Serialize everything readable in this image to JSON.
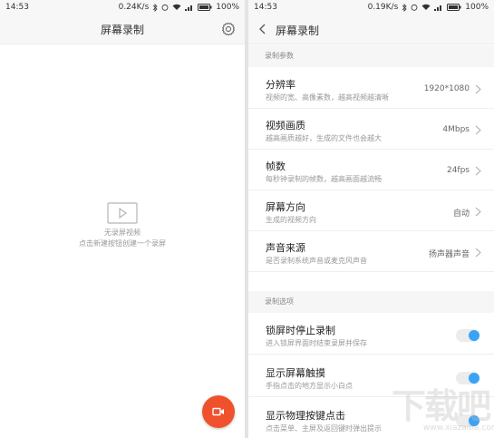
{
  "left": {
    "status": {
      "time": "14:53",
      "speed": "0.24K/s",
      "battery": "100%"
    },
    "title": "屏幕录制",
    "empty_line1": "无录屏视频",
    "empty_line2": "点击新建按钮创建一个录屏"
  },
  "right": {
    "status": {
      "time": "14:53",
      "speed": "0.19K/s",
      "battery": "100%"
    },
    "title": "屏幕录制",
    "section_params": "录制参数",
    "settings": [
      {
        "label": "分辨率",
        "desc": "视频的宽、高像素数，越高视频越清晰",
        "value": "1920*1080"
      },
      {
        "label": "视频画质",
        "desc": "越高画质越好，生成的文件也会越大",
        "value": "4Mbps"
      },
      {
        "label": "帧数",
        "desc": "每秒钟录制的帧数，越高画面越流畅",
        "value": "24fps"
      },
      {
        "label": "屏幕方向",
        "desc": "生成的视频方向",
        "value": "自动"
      },
      {
        "label": "声音来源",
        "desc": "是否录制系统声音或麦克风声音",
        "value": "扬声器声音"
      }
    ],
    "section_options": "录制选项",
    "toggles": [
      {
        "label": "锁屏时停止录制",
        "desc": "进入锁屏界面时结束录屏并保存",
        "on": true
      },
      {
        "label": "显示屏幕触摸",
        "desc": "手指点击的地方显示小白点",
        "on": true
      },
      {
        "label": "显示物理按键点击",
        "desc": "点击菜单、主屏及返回键时弹出提示",
        "on": true
      }
    ]
  },
  "watermark": {
    "text": "下载吧",
    "url": "www.xiazaiba.com"
  },
  "colors": {
    "accent": "#f0512d",
    "toggle_on": "#3aa3f5",
    "section_bg": "#f6f6f6"
  },
  "icons": [
    "gear-icon",
    "back-arrow-icon",
    "video-placeholder-icon",
    "record-icon",
    "chevron-right-icon"
  ]
}
